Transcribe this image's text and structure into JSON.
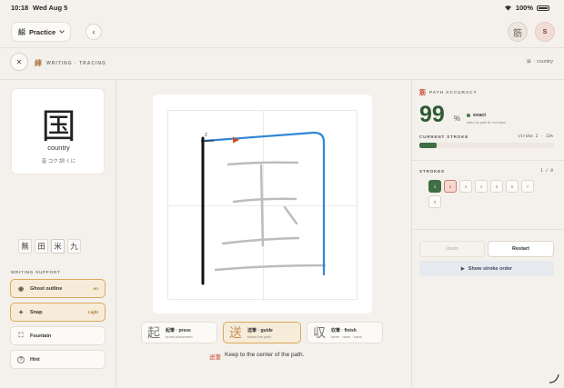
{
  "status_bar": {
    "time": "10:18",
    "date": "Wed Aug 5",
    "battery": "100%"
  },
  "topnav": {
    "practice_icon": "縂",
    "practice_label": "Practice",
    "back_glyph": "‹",
    "kanji_badge": "筋",
    "avatar_initial": "S"
  },
  "subheader": {
    "close_glyph": "✕",
    "kanji": "練",
    "crumb": "WRITING · TRACING",
    "right_icon": "⊞",
    "right_label": "· country"
  },
  "card": {
    "kanji": "国",
    "meaning": "country",
    "reading": "音 コク  訓 くに"
  },
  "components": [
    "無",
    "田",
    "米",
    "九"
  ],
  "support": {
    "label": "WRITING SUPPORT",
    "options": [
      {
        "icon": "◉",
        "label": "Ghost outline",
        "tail": "on"
      },
      {
        "icon": "✦",
        "label": "Snap",
        "tail": "Light"
      },
      {
        "icon": "⛶",
        "label": "Fountain",
        "tail": ""
      },
      {
        "icon": "?",
        "label": "Hint",
        "tail": ""
      }
    ]
  },
  "canvas": {
    "stroke_number": "2"
  },
  "modes": [
    {
      "mark": "起",
      "title": "起筆 · press",
      "sub": "brush placement"
    },
    {
      "mark": "送",
      "title": "送筆 · guide",
      "sub": "follow the path"
    },
    {
      "mark": "収",
      "title": "収筆 · finish",
      "sub": "tome · hane · harai"
    }
  ],
  "hint": {
    "jp": "送筆",
    "text": "Keep to the center of the path."
  },
  "accuracy": {
    "icon": "筋",
    "label": "PATH ACCURACY",
    "score": "99",
    "unit": "%",
    "status": "exact",
    "status_sub": "rated by path fit, not stars",
    "current_label": "CURRENT STROKE",
    "current_value": "stroke 2 · 13%",
    "progress": 0.13
  },
  "strokes": {
    "label": "STROKES",
    "count": "1 / 8",
    "items": [
      "1",
      "2",
      "3",
      "4",
      "5",
      "6",
      "7",
      "8"
    ]
  },
  "actions": {
    "undo": "Undo",
    "restart": "Restart",
    "show_order": "Show stroke order",
    "show_icon": "▶"
  },
  "colors": {
    "accent_green": "#3f6e45",
    "accent_gold": "#d9a95c",
    "accent_red": "#c94b2c",
    "guide_blue": "#2f86d6"
  }
}
